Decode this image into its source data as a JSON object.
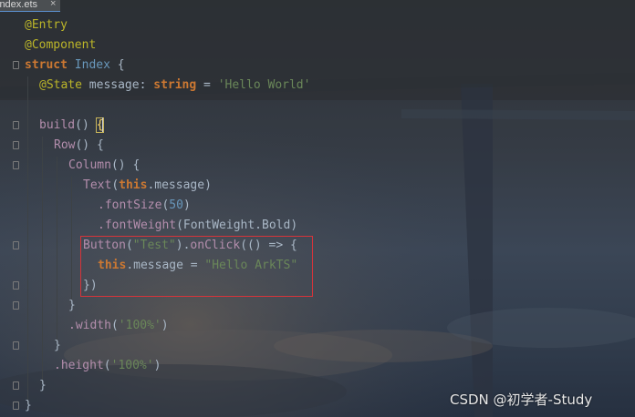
{
  "editor": {
    "tab_label": "index.ets",
    "tab_close_glyph": "×",
    "watermark": "CSDN @初学者-Study",
    "colors": {
      "annotation": "#bbb529",
      "keyword": "#cc7832",
      "string": "#6a8759",
      "number": "#6897bb",
      "plain": "#a9b7c6",
      "function": "#b48ead",
      "highlight_box": "#d6343a"
    }
  },
  "code_lines": [
    {
      "tokens": [
        {
          "t": "@Entry",
          "c": "annotation"
        }
      ]
    },
    {
      "tokens": [
        {
          "t": "@Component",
          "c": "annotation"
        }
      ]
    },
    {
      "tokens": [
        {
          "t": "struct",
          "c": "keyword"
        },
        {
          "t": " ",
          "c": "plain"
        },
        {
          "t": "Index",
          "c": "typename"
        },
        {
          "t": " {",
          "c": "plain"
        }
      ]
    },
    {
      "tokens": [
        {
          "t": "@State",
          "c": "annotation"
        },
        {
          "t": " message: ",
          "c": "plain"
        },
        {
          "t": "string",
          "c": "keyword"
        },
        {
          "t": " = ",
          "c": "plain"
        },
        {
          "t": "'Hello World'",
          "c": "str"
        }
      ]
    },
    {
      "tokens": []
    },
    {
      "tokens": [
        {
          "t": "build",
          "c": "func"
        },
        {
          "t": "() ",
          "c": "plain"
        },
        {
          "t": "{",
          "c": "braceHi"
        }
      ]
    },
    {
      "tokens": [
        {
          "t": "Row",
          "c": "func"
        },
        {
          "t": "() {",
          "c": "plain"
        }
      ]
    },
    {
      "tokens": [
        {
          "t": "Column",
          "c": "func"
        },
        {
          "t": "() {",
          "c": "plain"
        }
      ]
    },
    {
      "tokens": [
        {
          "t": "Text",
          "c": "func"
        },
        {
          "t": "(",
          "c": "plain"
        },
        {
          "t": "this",
          "c": "keyword"
        },
        {
          "t": ".message)",
          "c": "plain"
        }
      ]
    },
    {
      "tokens": [
        {
          "t": ".fontSize",
          "c": "func"
        },
        {
          "t": "(",
          "c": "plain"
        },
        {
          "t": "50",
          "c": "num"
        },
        {
          "t": ")",
          "c": "plain"
        }
      ]
    },
    {
      "tokens": [
        {
          "t": ".fontWeight",
          "c": "func"
        },
        {
          "t": "(FontWeight.Bold)",
          "c": "plain"
        }
      ]
    },
    {
      "tokens": [
        {
          "t": "Button",
          "c": "func"
        },
        {
          "t": "(",
          "c": "plain"
        },
        {
          "t": "\"Test\"",
          "c": "str"
        },
        {
          "t": ").",
          "c": "plain"
        },
        {
          "t": "onClick",
          "c": "func"
        },
        {
          "t": "(() => {",
          "c": "plain"
        }
      ]
    },
    {
      "tokens": [
        {
          "t": "this",
          "c": "keyword"
        },
        {
          "t": ".message = ",
          "c": "plain"
        },
        {
          "t": "\"Hello ArkTS\"",
          "c": "str"
        }
      ]
    },
    {
      "tokens": [
        {
          "t": "})",
          "c": "plain"
        }
      ]
    },
    {
      "tokens": [
        {
          "t": "}",
          "c": "plain"
        }
      ]
    },
    {
      "tokens": [
        {
          "t": ".width",
          "c": "func"
        },
        {
          "t": "(",
          "c": "plain"
        },
        {
          "t": "'100%'",
          "c": "str"
        },
        {
          "t": ")",
          "c": "plain"
        }
      ]
    },
    {
      "tokens": [
        {
          "t": "}",
          "c": "plain"
        }
      ]
    },
    {
      "tokens": [
        {
          "t": ".height",
          "c": "func"
        },
        {
          "t": "(",
          "c": "plain"
        },
        {
          "t": "'100%'",
          "c": "str"
        },
        {
          "t": ")",
          "c": "plain"
        }
      ]
    },
    {
      "tokens": [
        {
          "t": "}",
          "c": "plain"
        }
      ]
    },
    {
      "tokens": [
        {
          "t": "}",
          "c": "plain"
        }
      ]
    }
  ]
}
